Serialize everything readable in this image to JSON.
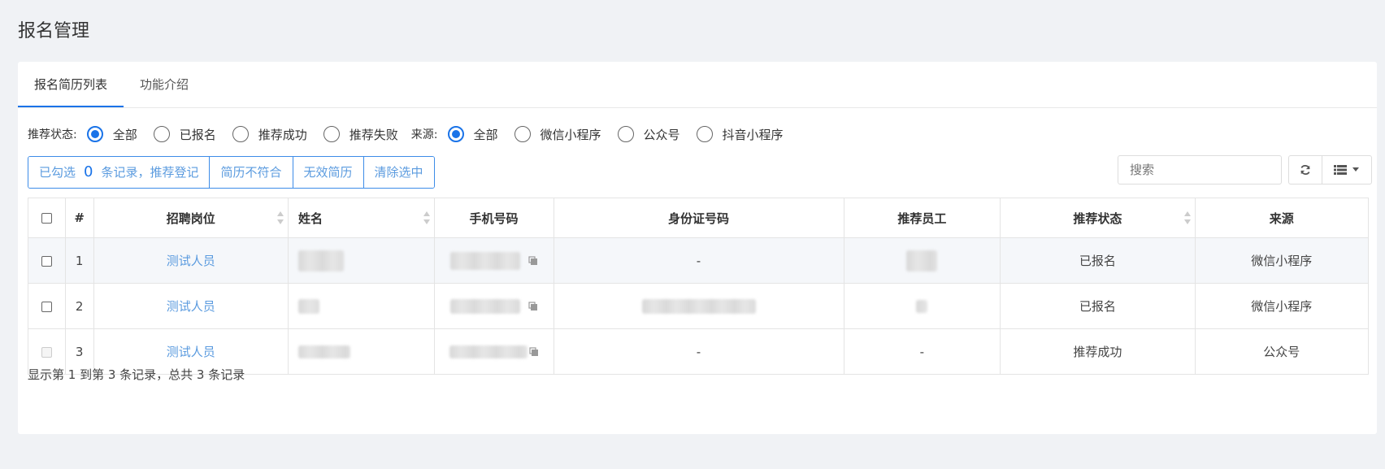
{
  "page": {
    "title": "报名管理"
  },
  "tabs": [
    {
      "label": "报名简历列表",
      "active": true
    },
    {
      "label": "功能介绍",
      "active": false
    }
  ],
  "filters": {
    "status": {
      "label": "推荐状态:",
      "options": [
        "全部",
        "已报名",
        "推荐成功",
        "推荐失败"
      ],
      "selected": "全部"
    },
    "source": {
      "label": "来源:",
      "options": [
        "全部",
        "微信小程序",
        "公众号",
        "抖音小程序"
      ],
      "selected": "全部"
    }
  },
  "actions": {
    "selected_prefix": "已勾选",
    "selected_count": "0",
    "selected_suffix": "条记录，推荐登记",
    "mismatch": "简历不符合",
    "invalid": "无效简历",
    "clear": "清除选中"
  },
  "toolbar": {
    "search_placeholder": "搜索",
    "refresh_icon": "refresh-icon",
    "columns_icon": "list-icon"
  },
  "table": {
    "headers": [
      "#",
      "招聘岗位",
      "姓名",
      "手机号码",
      "身份证号码",
      "推荐员工",
      "推荐状态",
      "来源"
    ],
    "rows": [
      {
        "num": "1",
        "position": "测试人员",
        "id_card": "-",
        "status": "已报名",
        "source": "微信小程序",
        "checkbox_disabled": false
      },
      {
        "num": "2",
        "position": "测试人员",
        "id_card": "",
        "status": "已报名",
        "source": "微信小程序",
        "checkbox_disabled": false
      },
      {
        "num": "3",
        "position": "测试人员",
        "id_card": "-",
        "employee": "-",
        "status": "推荐成功",
        "source": "公众号",
        "checkbox_disabled": true
      }
    ]
  },
  "footer": {
    "summary": "显示第 1 到第 3 条记录，总共 3 条记录"
  },
  "colors": {
    "accent": "#1a73e8",
    "link": "#5b9bdf",
    "border": "#e4e4e4",
    "background": "#f0f2f5"
  }
}
